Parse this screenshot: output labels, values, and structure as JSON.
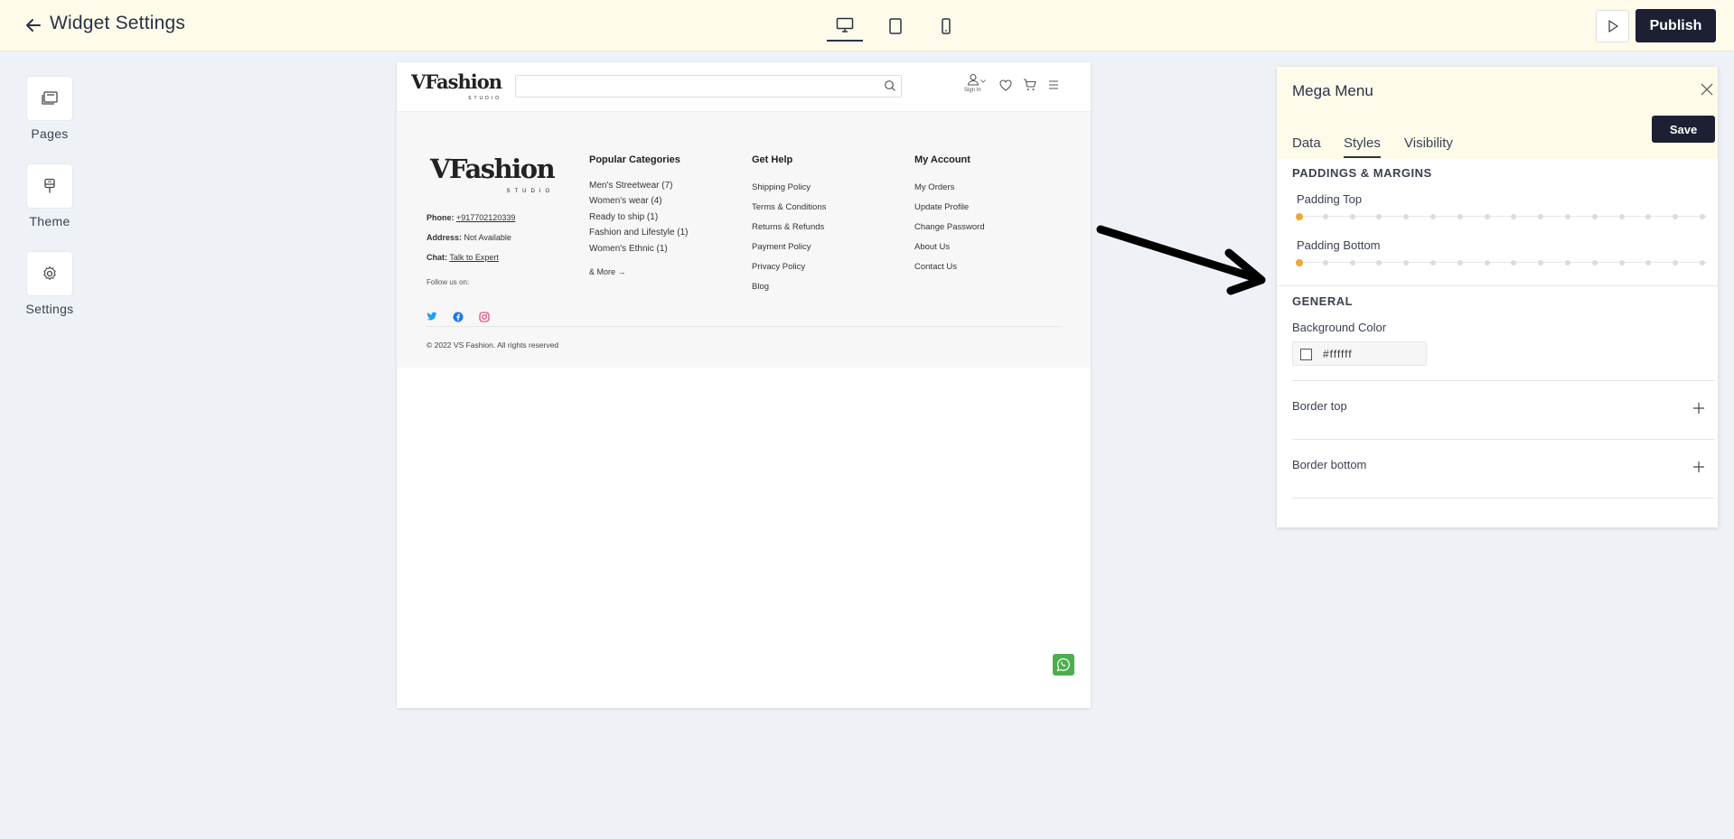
{
  "topbar": {
    "title": "Widget Settings",
    "publish_label": "Publish"
  },
  "rail": [
    {
      "label": "Pages",
      "icon": "pages-icon"
    },
    {
      "label": "Theme",
      "icon": "theme-icon"
    },
    {
      "label": "Settings",
      "icon": "gear-icon"
    }
  ],
  "preview": {
    "brand_main": "VFashion",
    "brand_sub": "STUDIO",
    "signin_label": "Sign In",
    "footer": {
      "contact": {
        "phone_label": "Phone:",
        "phone": "+917702120339",
        "address_label": "Address:",
        "address": "Not Available",
        "chat_label": "Chat:",
        "chat": "Talk to Expert",
        "follow": "Follow us on:"
      },
      "columns": [
        {
          "title": "Popular Categories",
          "links": [
            "Men's Streetwear (7)",
            "Women's wear (4)",
            "Ready to ship (1)",
            "Fashion and Lifestyle (1)",
            "Women's Ethnic (1)",
            "& More →"
          ]
        },
        {
          "title": "Get Help",
          "links": [
            "Shipping Policy",
            "Terms & Conditions",
            "Returns & Refunds",
            "Payment Policy",
            "Privacy Policy",
            "Blog"
          ]
        },
        {
          "title": "My Account",
          "links": [
            "My Orders",
            "Update Profile",
            "Change Password",
            "About Us",
            "Contact Us"
          ]
        }
      ],
      "copyright": "© 2022 VS Fashion. All rights reserved"
    }
  },
  "panel": {
    "title": "Mega Menu",
    "save_label": "Save",
    "tabs": [
      "Data",
      "Styles",
      "Visibility"
    ],
    "active_tab": "Styles",
    "paddings_title": "PADDINGS & MARGINS",
    "padding_top_label": "Padding Top",
    "padding_top_value": 0,
    "padding_bottom_label": "Padding Bottom",
    "padding_bottom_value": 0,
    "general_title": "GENERAL",
    "bg_color_label": "Background Color",
    "bg_color_value": "#ffffff",
    "border_top_label": "Border top",
    "border_bottom_label": "Border bottom"
  },
  "colors": {
    "topbar_bg": "#fefbea",
    "dark": "#1d2033",
    "slider_accent": "#f0a833",
    "whatsapp": "#4caf50",
    "twitter": "#1da1f2",
    "facebook": "#1877f2",
    "instagram": "#e1306c"
  }
}
